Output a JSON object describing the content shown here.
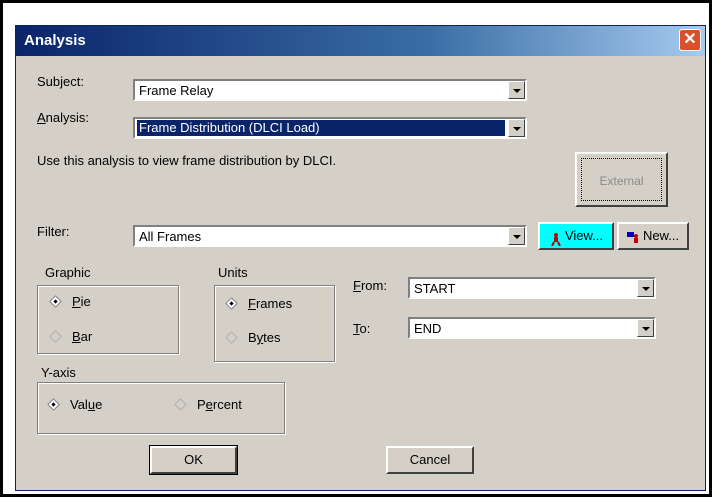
{
  "dialog": {
    "title": "Analysis",
    "close_glyph": "✕"
  },
  "subject": {
    "label": "Subject:",
    "value": "Frame Relay"
  },
  "analysis": {
    "label_rest": "nalysis:",
    "label_accel": "A",
    "value": "Frame Distribution (DLCI Load)"
  },
  "description": "Use this analysis to view frame distribution by DLCI.",
  "external_button": {
    "label": "External"
  },
  "filter": {
    "label": "Filter:",
    "value": "All Frames"
  },
  "view_button": {
    "label": "View...",
    "icon": "view-filter-icon",
    "color": "#00ffff"
  },
  "new_button": {
    "label": "New...",
    "icon": "new-filter-icon"
  },
  "graphic": {
    "title": "Graphic",
    "options": [
      {
        "accel": "P",
        "rest": "ie",
        "selected": true
      },
      {
        "accel": "B",
        "rest": "ar",
        "selected": false
      }
    ]
  },
  "units": {
    "title": "Units",
    "options": [
      {
        "accel": "F",
        "rest": "rames",
        "selected": true,
        "pre": ""
      },
      {
        "pre": "B",
        "accel": "y",
        "rest": "tes",
        "selected": false
      }
    ]
  },
  "from": {
    "accel": "F",
    "label_rest": "rom:",
    "value": "START"
  },
  "to": {
    "accel": "T",
    "label_rest": "o:",
    "value": "END"
  },
  "yaxis": {
    "title": "Y-axis",
    "options": [
      {
        "pre": "Val",
        "accel": "u",
        "rest": "e",
        "selected": true
      },
      {
        "pre": "P",
        "accel": "e",
        "rest": "rcent",
        "selected": false
      }
    ]
  },
  "ok_button": {
    "label": "OK"
  },
  "cancel_button": {
    "label": "Cancel"
  }
}
